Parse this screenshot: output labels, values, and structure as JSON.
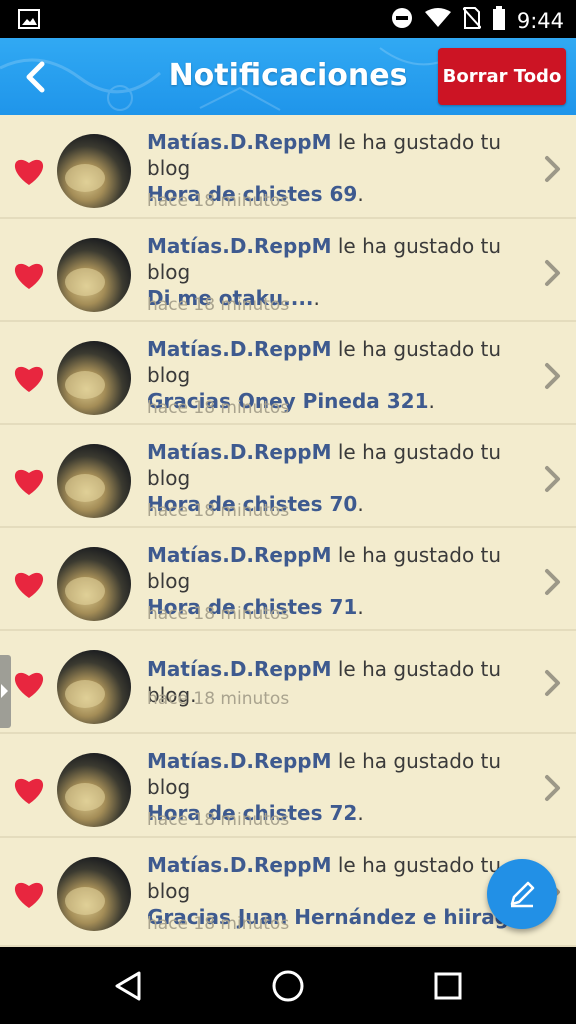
{
  "status_bar": {
    "time": "9:44",
    "icons": [
      "image-icon",
      "do-not-disturb-icon",
      "wifi-icon",
      "no-sim-icon",
      "battery-icon"
    ]
  },
  "header": {
    "title": "Notificaciones",
    "clear_all_label": "Borrar Todo",
    "back_icon": "chevron-left-icon",
    "colors": {
      "bar": "#2a9ff0",
      "clear_button": "#cc1424"
    }
  },
  "notifications": [
    {
      "user": "Matías.D.ReppM",
      "action": " le ha gustado tu blog",
      "blog": "Hora de chistes 69",
      "end": ".",
      "time": "hace 18 minutos"
    },
    {
      "user": "Matías.D.ReppM",
      "action": " le ha gustado tu blog",
      "blog": "Di me otaku....",
      "end": ".",
      "time": "hace 18 minutos"
    },
    {
      "user": "Matías.D.ReppM",
      "action": " le ha gustado tu blog",
      "blog": "Gracias Oney Pineda 321",
      "end": ".",
      "time": "hace 18 minutos"
    },
    {
      "user": "Matías.D.ReppM",
      "action": " le ha gustado tu blog",
      "blog": "Hora de chistes 70",
      "end": ".",
      "time": "hace 18 minutos"
    },
    {
      "user": "Matías.D.ReppM",
      "action": " le ha gustado tu blog",
      "blog": "Hora de chistes 71",
      "end": ".",
      "time": "hace 18 minutos"
    },
    {
      "user": "Matías.D.ReppM",
      "action": " le ha gustado tu blog.",
      "blog": "",
      "end": "",
      "time": "hace 18 minutos"
    },
    {
      "user": "Matías.D.ReppM",
      "action": " le ha gustado tu blog",
      "blog": "Hora de chistes 72",
      "end": ".",
      "time": "hace 18 minutos"
    },
    {
      "user": "Matías.D.ReppM",
      "action": " le ha gustado tu blog",
      "blog": "Gracias Juan Hernández e hiiragi.",
      "end": "",
      "time": "hace 18 minutos"
    }
  ],
  "fab": {
    "icon": "pencil-icon"
  },
  "nav_bar": {
    "icons": [
      "back-triangle-icon",
      "home-circle-icon",
      "recents-square-icon"
    ]
  },
  "colors": {
    "background": "#f3ecce",
    "heart": "#e8263f",
    "link_text": "#3e5a8f",
    "time_text": "#a9a38e",
    "fab": "#2290e6"
  }
}
